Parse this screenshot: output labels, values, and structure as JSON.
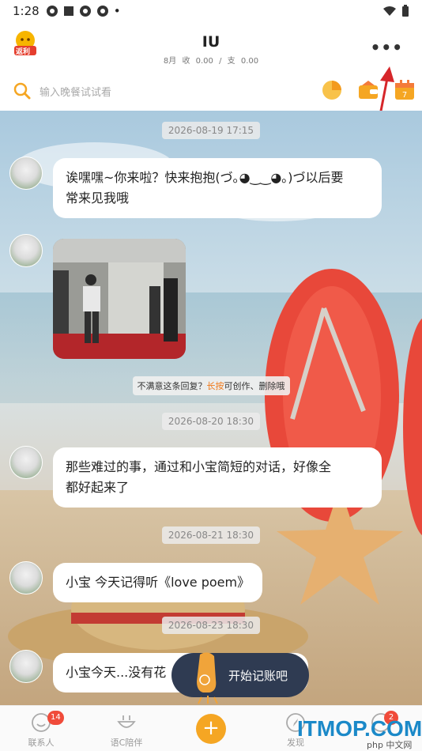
{
  "status_bar": {
    "time": "1:28",
    "dot": "•"
  },
  "header": {
    "badge_text": "返利",
    "title": "IU",
    "month": "8月",
    "income_label": "收",
    "income_value": "0.00",
    "sep": "/",
    "expense_label": "支",
    "expense_value": "0.00",
    "more_label": "•••"
  },
  "search": {
    "placeholder": "输入晚餐试试看"
  },
  "messages": [
    {
      "timestamp": "2026-08-19  17:15",
      "text_line1": "诶嘿嘿~你来啦？快来抱抱(づ｡◕‿‿◕｡)づ以后要",
      "text_line2": "常来见我哦"
    },
    {
      "kind": "image"
    },
    {
      "tip_prefix": "不满意这条回复？",
      "tip_highlight": "长按",
      "tip_suffix": "可创作、删除哦"
    },
    {
      "timestamp": "2026-08-20  18:30",
      "text_line1": "那些难过的事，通过和小宝简短的对话，好像全",
      "text_line2": "都好起来了"
    },
    {
      "timestamp": "2026-08-21  18:30",
      "text_line1": "小宝 今天记得听《love poem》"
    },
    {
      "timestamp": "2026-08-23  18:30",
      "text_line1": "小宝今天...没有花"
    }
  ],
  "start_button": {
    "label": "开始记账吧"
  },
  "bottom_nav": {
    "contacts": {
      "label": "联系人",
      "badge": "14"
    },
    "companion": {
      "label": "语C陪伴"
    },
    "add": {
      "label": "+"
    },
    "discover": {
      "label": "发现"
    },
    "messages": {
      "badge": "2"
    }
  },
  "watermark": {
    "text": "ITMOP.COM",
    "php": "php 中文网"
  },
  "colors": {
    "accent": "#f5a623",
    "highlight": "#f07a1b",
    "badge": "#f04b3a",
    "start_button": "#2f3b52"
  }
}
